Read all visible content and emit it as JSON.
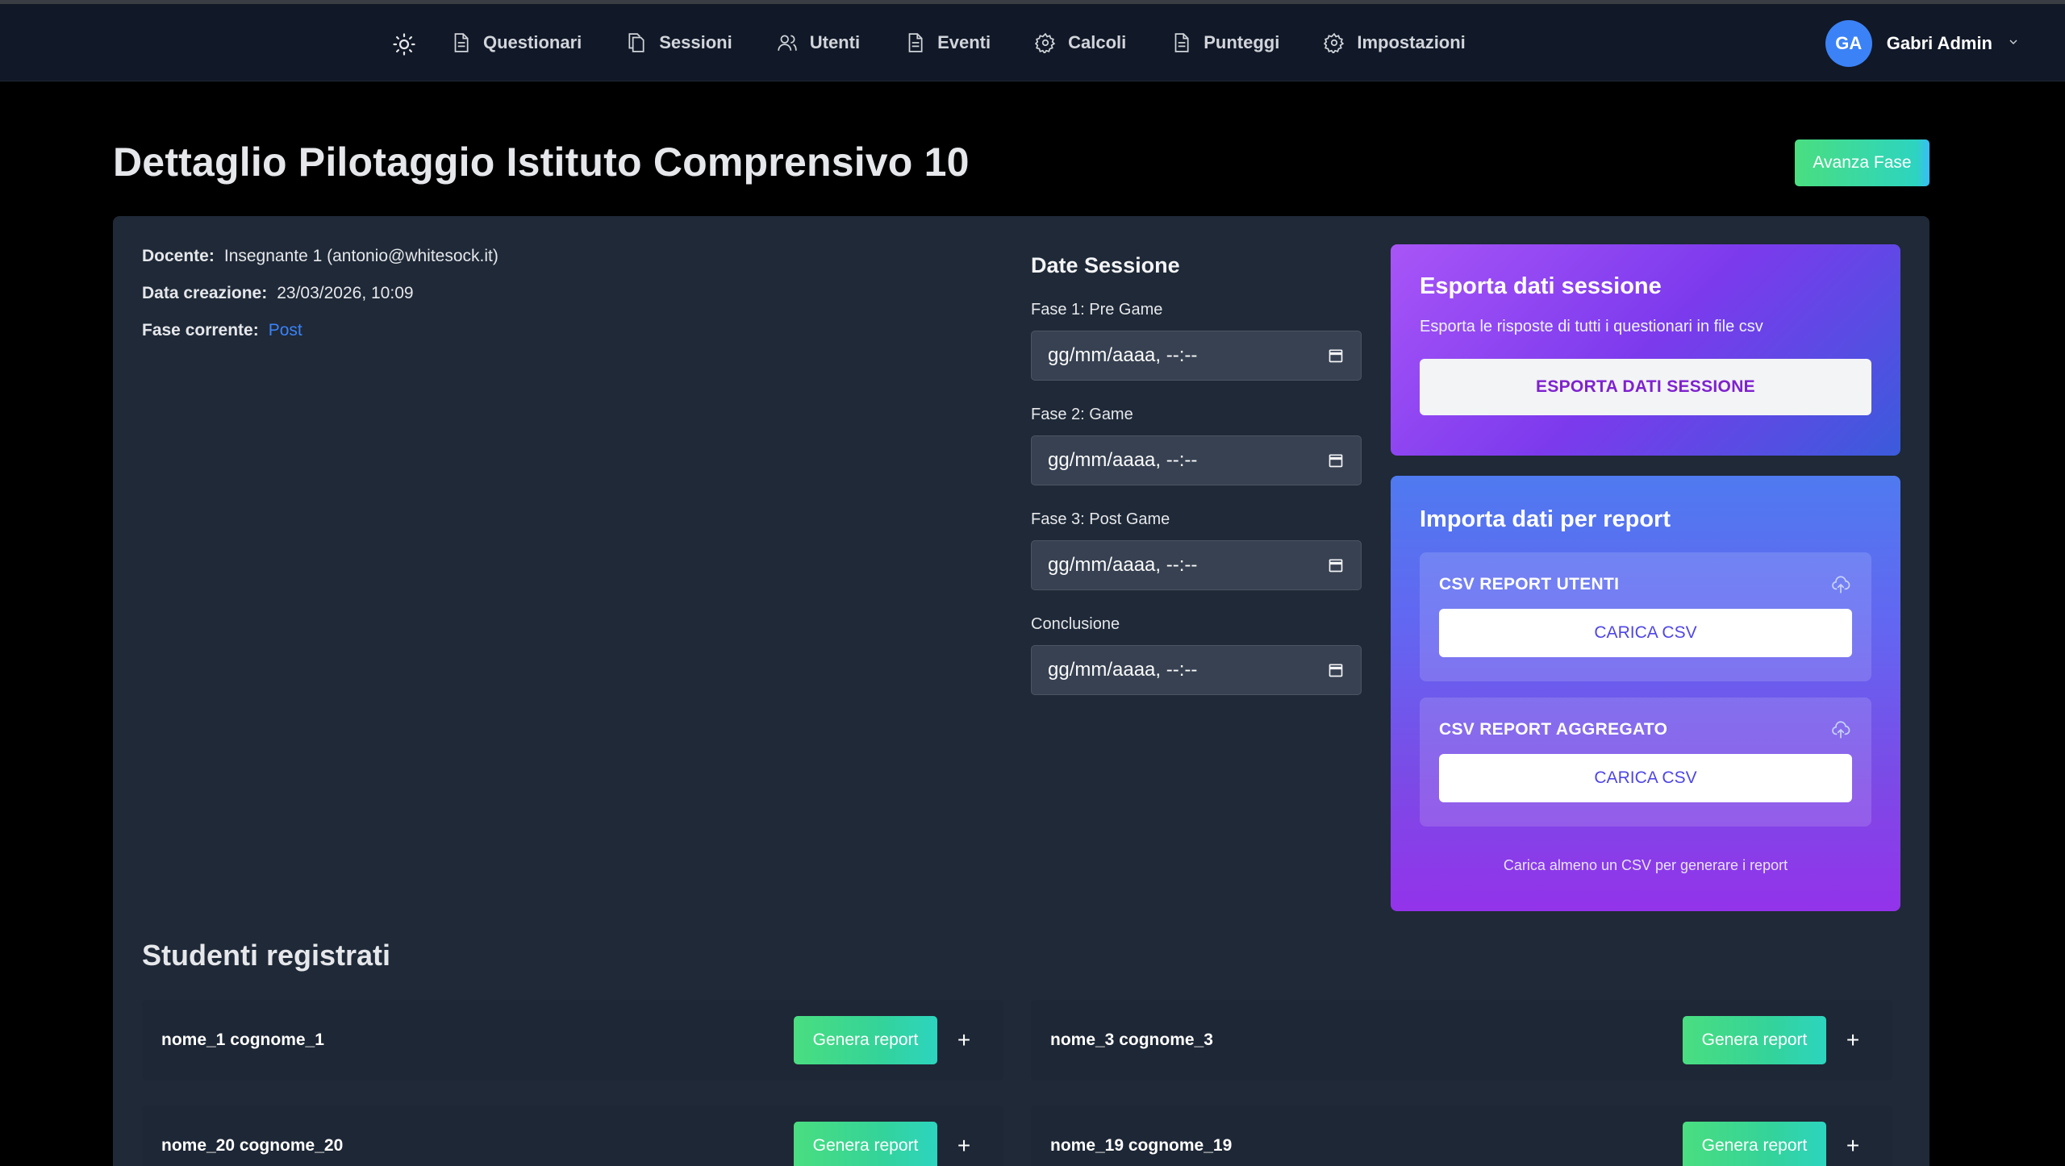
{
  "nav": {
    "items": [
      {
        "label": "Questionari",
        "icon": "document-icon"
      },
      {
        "label": "Sessioni",
        "icon": "copy-icon"
      },
      {
        "label": "Utenti",
        "icon": "users-icon"
      },
      {
        "label": "Eventi",
        "icon": "document-icon"
      },
      {
        "label": "Calcoli",
        "icon": "gear-icon"
      },
      {
        "label": "Punteggi",
        "icon": "document-icon"
      },
      {
        "label": "Impostazioni",
        "icon": "gear-icon"
      }
    ],
    "theme_icon": "sun-icon",
    "user": {
      "initials": "GA",
      "name": "Gabri Admin"
    }
  },
  "header": {
    "title": "Dettaglio Pilotaggio Istituto Comprensivo 10",
    "advance_label": "Avanza Fase"
  },
  "info": {
    "teacher_label": "Docente:",
    "teacher_value": "Insegnante 1 (antonio@whitesock.it)",
    "created_label": "Data creazione:",
    "created_value": "23/03/2026, 10:09",
    "phase_label": "Fase corrente:",
    "phase_value": "Post"
  },
  "dates": {
    "title": "Date Sessione",
    "fields": [
      {
        "label": "Fase 1: Pre Game",
        "placeholder": "gg/mm/aaaa, --:--"
      },
      {
        "label": "Fase 2: Game",
        "placeholder": "gg/mm/aaaa, --:--"
      },
      {
        "label": "Fase 3: Post Game",
        "placeholder": "gg/mm/aaaa, --:--"
      },
      {
        "label": "Conclusione",
        "placeholder": "gg/mm/aaaa, --:--"
      }
    ]
  },
  "export": {
    "title": "Esporta dati sessione",
    "subtitle": "Esporta le risposte di tutti i questionari in file csv",
    "button": "ESPORTA DATI SESSIONE"
  },
  "import": {
    "title": "Importa dati per report",
    "users_title": "CSV REPORT UTENTI",
    "aggregate_title": "CSV REPORT AGGREGATO",
    "button": "CARICA CSV",
    "note": "Carica almeno un CSV per generare i report"
  },
  "students": {
    "title": "Studenti registrati",
    "report_label": "Genera report",
    "plus_label": "+",
    "items": [
      {
        "name": "nome_1 cognome_1"
      },
      {
        "name": "nome_3 cognome_3"
      },
      {
        "name": "nome_20 cognome_20"
      },
      {
        "name": "nome_19 cognome_19"
      }
    ]
  },
  "colors": {
    "background": "#000000",
    "navbar": "#111827",
    "card": "#1f2937",
    "accent": "#3b82f6",
    "success": "#4ade80"
  }
}
